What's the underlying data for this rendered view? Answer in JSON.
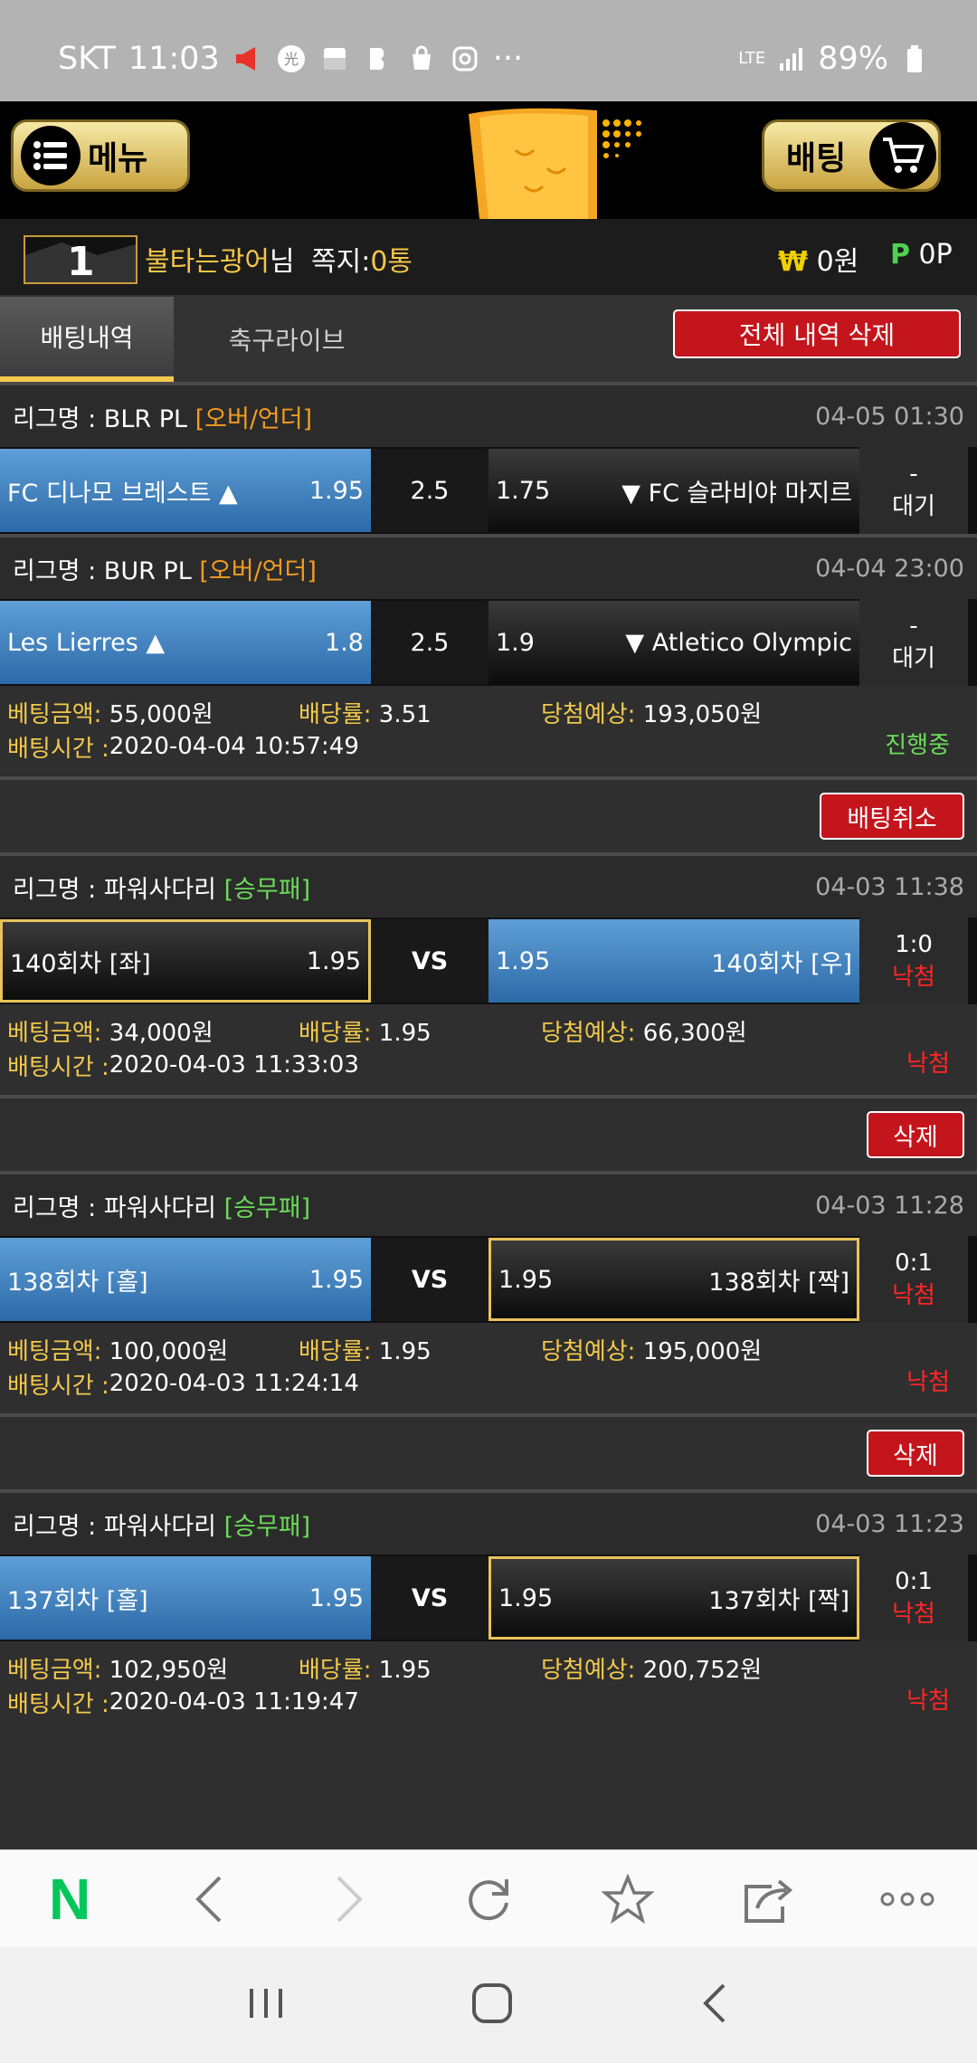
{
  "status_bar": {
    "carrier": "SKT",
    "time": "11:03",
    "network": "LTE",
    "battery": "89%",
    "more": "···"
  },
  "header": {
    "menu_label": "메뉴",
    "bet_label": "배팅"
  },
  "user": {
    "rank": "1",
    "name": "불타는광어",
    "honorific": "님",
    "memo_label": "쪽지:",
    "memo_count": "0통",
    "money_symbol": "₩",
    "money": "0원",
    "points_symbol": "P",
    "points": "0P"
  },
  "tabs": {
    "active": "배팅내역",
    "inactive": "축구라이브",
    "delete_all": "전체 내역 삭제"
  },
  "labels": {
    "league_prefix": "리그명 : ",
    "amount": "베팅금액:",
    "rate": "배당률:",
    "expected": "당첨예상:",
    "time": "배팅시간 : "
  },
  "bets": [
    {
      "leagues": [
        {
          "name": "BLR PL",
          "type": "[오버/언더]",
          "time": "04-05 01:30",
          "home": "FC 디나모 브레스트 ▲",
          "home_odds": "1.95",
          "mid": "2.5",
          "away_odds": "1.75",
          "away": "▼ FC 슬라비야 마지르",
          "result_top": "-",
          "result_bottom": "대기"
        },
        {
          "name": "BUR PL",
          "type": "[오버/언더]",
          "time": "04-04 23:00",
          "home": "Les Lierres ▲",
          "home_odds": "1.8",
          "mid": "2.5",
          "away_odds": "1.9",
          "away": "▼ Atletico Olympic",
          "result_top": "-",
          "result_bottom": "대기"
        }
      ],
      "amount": "55,000원",
      "rate": "3.51",
      "expected": "193,050원",
      "bet_time": "2020-04-04 10:57:49",
      "status": "진행중",
      "action": "배팅취소"
    },
    {
      "leagues": [
        {
          "name": "파워사다리",
          "type": "[승무패]",
          "time": "04-03 11:38",
          "home": "140회차 [좌]",
          "home_odds": "1.95",
          "mid": "VS",
          "away_odds": "1.95",
          "away": "140회차 [우]",
          "result_top": "1:0",
          "result_bottom": "낙첨"
        }
      ],
      "amount": "34,000원",
      "rate": "1.95",
      "expected": "66,300원",
      "bet_time": "2020-04-03 11:33:03",
      "status": "낙첨",
      "action": "삭제"
    },
    {
      "leagues": [
        {
          "name": "파워사다리",
          "type": "[승무패]",
          "time": "04-03 11:28",
          "home": "138회차 [홀]",
          "home_odds": "1.95",
          "mid": "VS",
          "away_odds": "1.95",
          "away": "138회차 [짝]",
          "result_top": "0:1",
          "result_bottom": "낙첨"
        }
      ],
      "amount": "100,000원",
      "rate": "1.95",
      "expected": "195,000원",
      "bet_time": "2020-04-03 11:24:14",
      "status": "낙첨",
      "action": "삭제"
    },
    {
      "leagues": [
        {
          "name": "파워사다리",
          "type": "[승무패]",
          "time": "04-03 11:23",
          "home": "137회차 [홀]",
          "home_odds": "1.95",
          "mid": "VS",
          "away_odds": "1.95",
          "away": "137회차 [짝]",
          "result_top": "0:1",
          "result_bottom": "낙첨"
        }
      ],
      "amount": "102,950원",
      "rate": "1.95",
      "expected": "200,752원",
      "bet_time": "2020-04-03 11:19:47",
      "status": "낙첨"
    }
  ],
  "browser": {
    "home_label": "N"
  },
  "colors": {
    "accent_gold": "#f2c94c",
    "danger_red": "#c4151c",
    "status_green": "#6cdc5a",
    "status_red": "#ff2626",
    "selection_blue": "#3b7fc0",
    "naver_green": "#03c75a"
  }
}
